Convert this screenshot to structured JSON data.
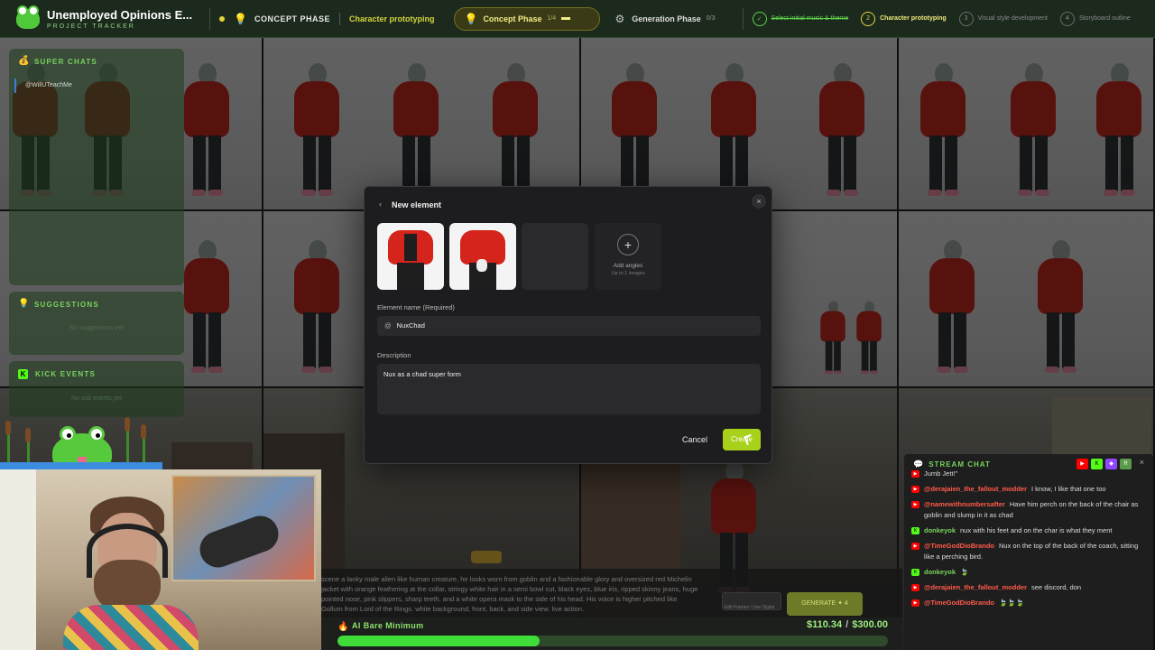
{
  "topbar": {
    "brand_title": "Unemployed Opinions E...",
    "brand_sub": "PROJECT TRACKER",
    "phase_label": "CONCEPT PHASE",
    "phase_sub": "Character prototyping",
    "pill_label": "Concept Phase",
    "pill_count": "1/4",
    "gen_label": "Generation Phase",
    "gen_count": "0/3",
    "steps": [
      {
        "num": "✓",
        "label": "Select initial music & theme",
        "state": "done"
      },
      {
        "num": "2",
        "label": "Character prototyping",
        "state": "active"
      },
      {
        "num": "3",
        "label": "Visual style development",
        "state": "todo"
      },
      {
        "num": "4",
        "label": "Storyboard outline",
        "state": "todo"
      }
    ]
  },
  "panels": {
    "super_chats": {
      "title": "SUPER CHATS",
      "user": "@WillUTeachMe"
    },
    "suggestions": {
      "title": "SUGGESTIONS",
      "empty": "No suggestions yet"
    },
    "kick_events": {
      "title": "KICK EVENTS",
      "empty": "No sub events yet"
    }
  },
  "modal": {
    "title": "New element",
    "add_angles": "Add angles",
    "add_angles_sub": "Up to 1 images",
    "name_label": "Element name (Required)",
    "name_value": "NuxChad",
    "desc_label": "Description",
    "desc_value": "Nux as a chad super form",
    "cancel": "Cancel",
    "create": "Create"
  },
  "prompt": {
    "text": "scene a lanky male alien like human creature, he looks worn from goblin and a fashionable glory and oversized red Michelin jacket with orange feathering at the collar, stringy white hair in a semi bowl cut, black eyes, blue iris, ripped skinny jeans, huge pointed nose, pink slippers, sharp teeth, and a white opera mask to the side of his head. His voice is higher pitched like Gollum from Lord of the Rings. white background, front, back, and side view. live action.",
    "generate": "GENERATE ✦ 4",
    "small_box": "Edit Frames / Use Digital"
  },
  "goal": {
    "name": "AI Bare Minimum",
    "current": "$110.34",
    "target": "$300.00",
    "progress": 0.368
  },
  "chat": {
    "title": "STREAM CHAT",
    "messages": [
      {
        "platform": "yt",
        "user": "",
        "text": "Jumb Jett!\""
      },
      {
        "platform": "yt",
        "user": "@derajaien_the_fallout_modder",
        "text": "I know, I like that one too"
      },
      {
        "platform": "yt",
        "user": "@namewithnumbersafter",
        "text": "Have him perch on the back of the chair as goblin and slump in it as chad"
      },
      {
        "platform": "kick",
        "user": "donkeyok",
        "text": "nux with his feet and on the char is what they ment"
      },
      {
        "platform": "yt",
        "user": "@TimeGodDioBrando",
        "text": "Nux on the top of the back of the coach, sitting like a perching bird."
      },
      {
        "platform": "kick",
        "user": "donkeyok",
        "text": "🍃"
      },
      {
        "platform": "yt",
        "user": "@derajaien_the_fallout_modder",
        "text": "see discord, don"
      },
      {
        "platform": "yt",
        "user": "@TimeGodDioBrando",
        "text": "🍃🍃🍃"
      }
    ]
  },
  "colors": {
    "accent_green": "#78d45c",
    "create_button": "#a7d11b",
    "youtube": "#ff0000",
    "kick": "#53fc18"
  }
}
